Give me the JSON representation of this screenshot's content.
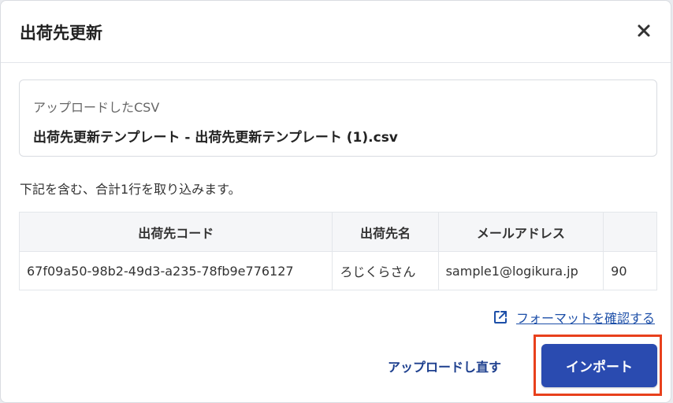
{
  "dialog": {
    "title": "出荷先更新"
  },
  "upload": {
    "label": "アップロードしたCSV",
    "file_name": "出荷先更新テンプレート - 出荷先更新テンプレート (1).csv"
  },
  "summary": "下記を含む、合計1行を取り込みます。",
  "table": {
    "headers": [
      "出荷先コード",
      "出荷先名",
      "メールアドレス",
      ""
    ],
    "rows": [
      [
        "67f09a50-98b2-49d3-a235-78fb9e776127",
        "ろじくらさん",
        "sample1@logikura.jp",
        "90"
      ]
    ]
  },
  "links": {
    "format": "フォーマットを確認する"
  },
  "actions": {
    "reupload": "アップロードし直す",
    "import": "インポート"
  },
  "colors": {
    "primary": "#2a4bb0",
    "link": "#1d4fa8",
    "highlight": "#e8401c"
  }
}
